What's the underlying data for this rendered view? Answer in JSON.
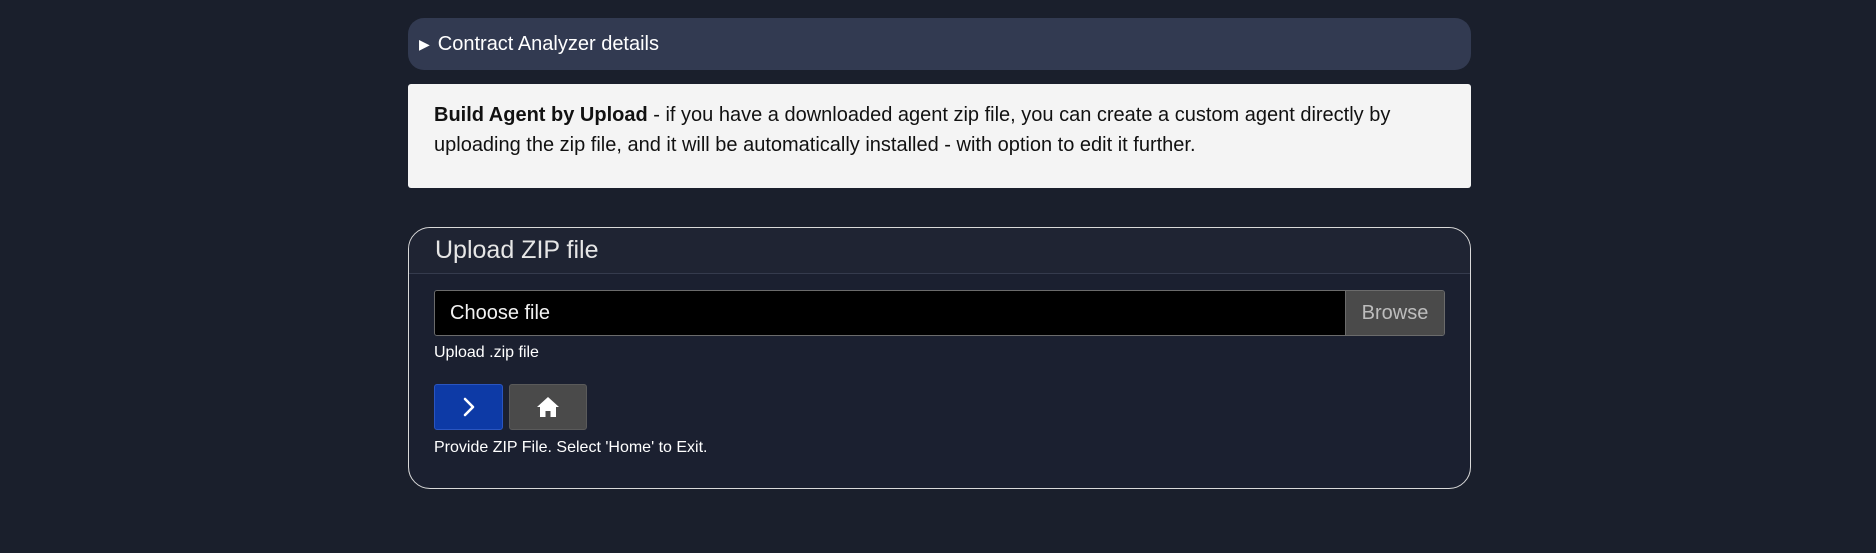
{
  "details": {
    "label": "Contract Analyzer details",
    "triangle_icon": "caret-right-icon"
  },
  "info": {
    "title": "Build Agent by Upload",
    "text": " - if you have a downloaded agent zip file, you can create a custom agent directly by uploading the zip file, and it will be automatically installed - with option to edit it further."
  },
  "upload": {
    "header": "Upload ZIP file",
    "choose_label": "Choose file",
    "browse_label": "Browse",
    "hint": "Upload .zip file",
    "next_icon": "chevron-right-icon",
    "home_icon": "home-icon",
    "status": "Provide ZIP File. Select 'Home' to Exit."
  },
  "colors": {
    "background": "#1a1f2c",
    "details_bar": "#323a51",
    "primary_button": "#0d3aa6",
    "secondary_button": "#4a4a4a"
  }
}
